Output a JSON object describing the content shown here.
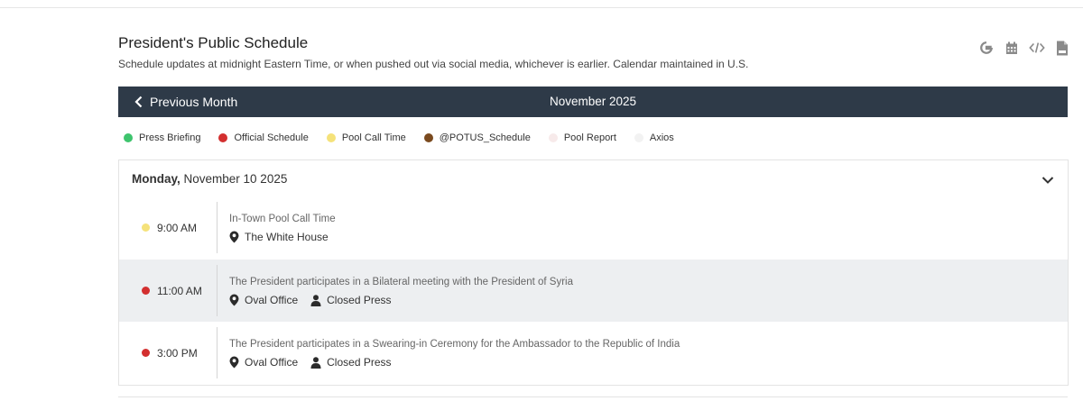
{
  "header": {
    "title": "President's Public Schedule",
    "subtitle": "Schedule updates at midnight Eastern Time, or when pushed out via social media, whichever is earlier. Calendar maintained in U.S."
  },
  "toolbar": {
    "icons": [
      "google-icon",
      "calendar-icon",
      "embed-code-icon",
      "csv-file-icon"
    ]
  },
  "month_bar": {
    "prev_label": "Previous Month",
    "month": "November 2025"
  },
  "legend": [
    {
      "label": "Press Briefing",
      "color": "#3ec46d"
    },
    {
      "label": "Official Schedule",
      "color": "#d32f2f"
    },
    {
      "label": "Pool Call Time",
      "color": "#f5e27a"
    },
    {
      "label": "@POTUS_Schedule",
      "color": "#7a4a1e"
    },
    {
      "label": "Pool Report",
      "color": "#f7eaea"
    },
    {
      "label": "Axios",
      "color": "#f2f2f2"
    }
  ],
  "day": {
    "weekday": "Monday,",
    "date": "November 10 2025",
    "events": [
      {
        "time": "9:00 AM",
        "dot_color": "#f5e27a",
        "title": "In-Town Pool Call Time",
        "location": "The White House",
        "press": ""
      },
      {
        "time": "11:00 AM",
        "dot_color": "#d32f2f",
        "title": "The President participates in a Bilateral meeting with the President of Syria",
        "location": "Oval Office",
        "press": "Closed Press"
      },
      {
        "time": "3:00 PM",
        "dot_color": "#d32f2f",
        "title": "The President participates in a Swearing-in Ceremony for the Ambassador to the Republic of India",
        "location": "Oval Office",
        "press": "Closed Press"
      }
    ]
  }
}
